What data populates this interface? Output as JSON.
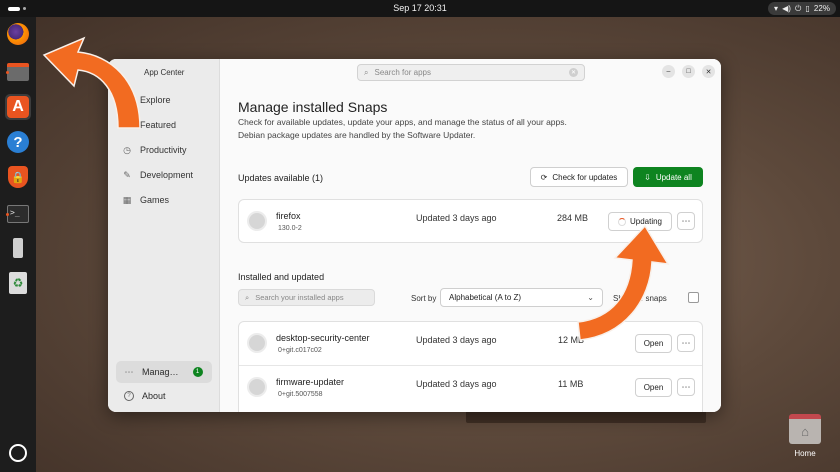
{
  "topbar": {
    "clock": "Sep 17  20:31",
    "battery": "22%",
    "icons": [
      "wifi-icon",
      "volume-icon",
      "power-icon",
      "battery-icon"
    ]
  },
  "dock": {
    "items": [
      {
        "name": "firefox-icon",
        "label": ""
      },
      {
        "name": "files-icon",
        "label": ""
      },
      {
        "name": "app-center-icon",
        "label": "A"
      },
      {
        "name": "help-icon",
        "label": "?"
      },
      {
        "name": "security-center-icon",
        "label": ""
      },
      {
        "name": "terminal-icon",
        "label": ">_"
      },
      {
        "name": "usb-drive-icon",
        "label": ""
      },
      {
        "name": "trash-icon",
        "label": "♻"
      },
      {
        "name": "show-apps-icon",
        "label": ""
      }
    ]
  },
  "desktop": {
    "home_label": "Home"
  },
  "window": {
    "app_title": "App Center",
    "search_placeholder": "Search for apps",
    "sidebar": {
      "items": [
        {
          "label": "Explore",
          "icon": "explore-icon"
        },
        {
          "label": "Featured",
          "icon": "star-icon"
        },
        {
          "label": "Productivity",
          "icon": "clock-icon"
        },
        {
          "label": "Development",
          "icon": "wrench-icon"
        },
        {
          "label": "Games",
          "icon": "gamepad-icon"
        }
      ],
      "manage_label": "Manag…",
      "manage_badge": "1",
      "about_label": "About"
    },
    "page_title": "Manage installed Snaps",
    "description_line1": "Check for available updates, update your apps, and manage the status of all your apps.",
    "description_line2": "Debian package updates are handled by the Software Updater.",
    "updates": {
      "title": "Updates available (1)",
      "check_button": "Check for updates",
      "update_all_button": "Update all",
      "items": [
        {
          "name": "firefox",
          "version": "130.0-2",
          "updated": "Updated 3 days ago",
          "size": "284 MB",
          "action": "Updating"
        }
      ]
    },
    "installed": {
      "title": "Installed and updated",
      "search_placeholder": "Search your installed apps",
      "sort_label": "Sort by",
      "sort_value": "Alphabetical (A to Z)",
      "show_label": "Show … snaps",
      "items": [
        {
          "name": "desktop-security-center",
          "version": "0+git.c017c02",
          "updated": "Updated 3 days ago",
          "size": "12 MB",
          "action": "Open"
        },
        {
          "name": "firmware-updater",
          "version": "0+git.5007558",
          "updated": "Updated 3 days ago",
          "size": "11 MB",
          "action": "Open"
        }
      ]
    }
  },
  "colors": {
    "accent_orange": "#e95420",
    "success_green": "#0e8420",
    "arrow_orange": "#f26b21"
  }
}
